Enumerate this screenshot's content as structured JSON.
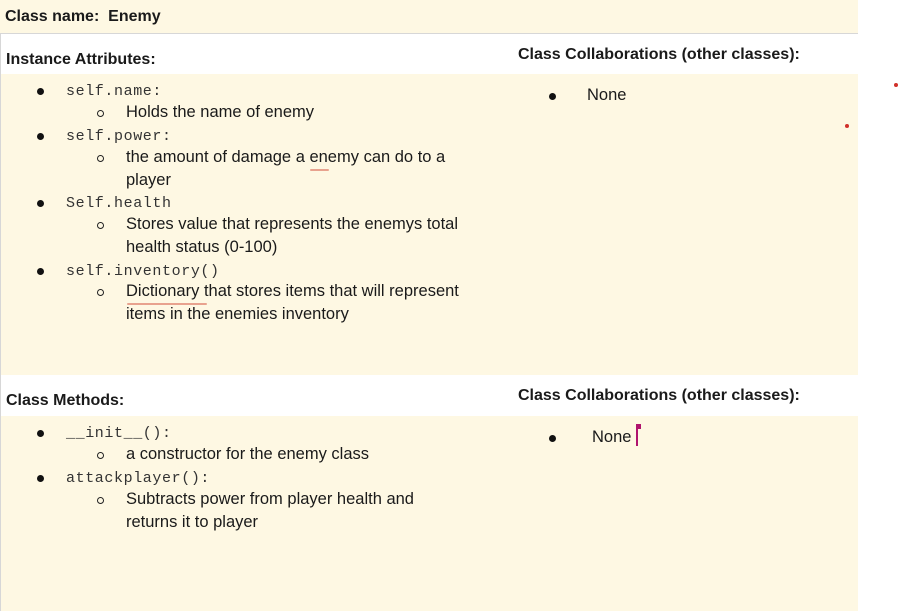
{
  "class_name": {
    "label": "Class name:",
    "value": "Enemy"
  },
  "attributes_section": {
    "header": "Instance Attributes:",
    "collab_header": "Class Collaborations (other classes):",
    "collab_items": [
      "None"
    ],
    "items": [
      {
        "code": "self.name:",
        "description": [
          "Holds the name of enemy"
        ]
      },
      {
        "code": "self.power:",
        "description": [
          "the amount of damage a enemy can do to a",
          "player"
        ]
      },
      {
        "code": "Self.health",
        "description": [
          "Stores value that represents the enemys total",
          "health status (0-100)"
        ]
      },
      {
        "code": "self.inventory()",
        "description": [
          "Dictionary that stores items that will represent",
          "items in the enemies inventory"
        ]
      }
    ]
  },
  "methods_section": {
    "header": "Class Methods:",
    "collab_header": "Class Collaborations (other classes):",
    "collab_items": [
      "None"
    ],
    "items": [
      {
        "code": "__init__():",
        "description": [
          "a constructor for the enemy class"
        ]
      },
      {
        "code": "attackplayer():",
        "description": [
          "Subtracts power from player health  and",
          "returns it to player"
        ]
      }
    ]
  },
  "colors": {
    "cell_fill": "#fef8e3",
    "grid": "#d7d7d7",
    "spell_underline": "#e8a28e",
    "cursor": "#b0146e",
    "marker_dot": "#d0302a"
  }
}
